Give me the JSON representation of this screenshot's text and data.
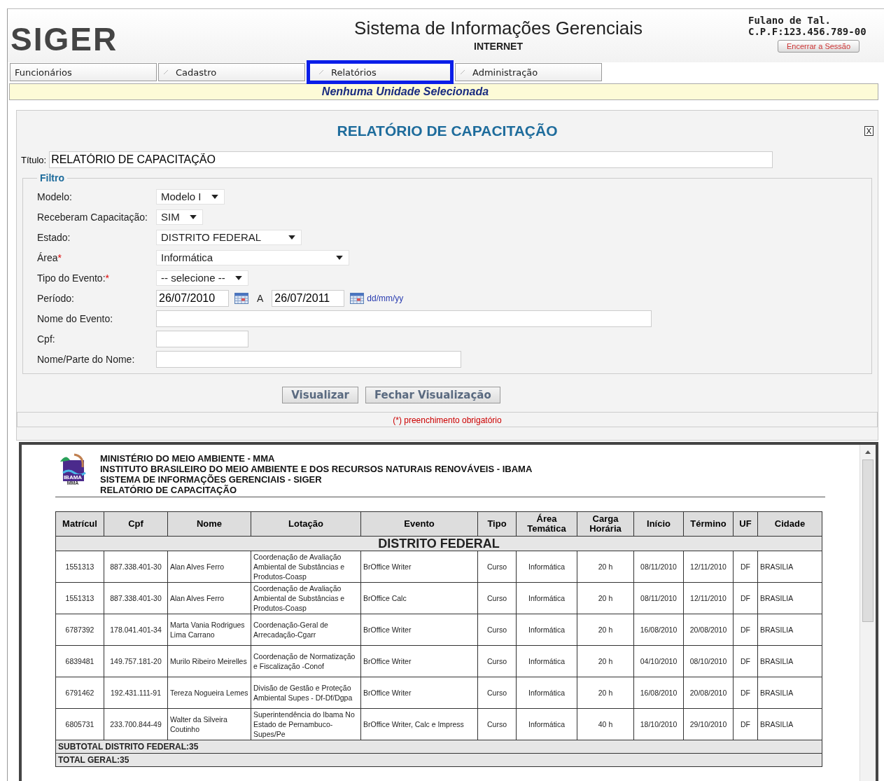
{
  "header": {
    "logo": "SIGER",
    "title": "Sistema de Informações Gerenciais",
    "subtitle": "INTERNET",
    "user_name": "Fulano de Tal.",
    "user_cpf": "C.P.F:123.456.789-00",
    "logout_button": "Encerrar a Sessão"
  },
  "tabs": [
    {
      "label": "Funcionários",
      "selected": false
    },
    {
      "label": "Cadastro",
      "selected": false
    },
    {
      "label": "Relatórios",
      "selected": true
    },
    {
      "label": "Administração",
      "selected": false
    }
  ],
  "unit_banner": "Nenhuma Unidade Selecionada",
  "panel": {
    "title": "RELATÓRIO DE CAPACITAÇÃO",
    "close": "X",
    "title_label": "Título:",
    "title_value": "RELATÓRIO DE CAPACITAÇÃO"
  },
  "filter": {
    "legend": "Filtro",
    "fields": [
      {
        "kind": "select",
        "label": "Modelo:",
        "value": "Modelo I"
      },
      {
        "kind": "select",
        "label": "Receberam Capacitação:",
        "value": "SIM"
      },
      {
        "kind": "select",
        "label": "Estado:",
        "value": "DISTRITO FEDERAL"
      },
      {
        "kind": "select",
        "label": "Área",
        "mark": "*",
        "value": "Informática"
      },
      {
        "kind": "select",
        "label": "Tipo do Evento:",
        "mark": "*",
        "value": "-- selecione --"
      },
      {
        "kind": "period",
        "label": "Período:",
        "from": "26/07/2010",
        "joiner": "A",
        "to": "26/07/2011",
        "hint": "dd/mm/yy"
      },
      {
        "kind": "text",
        "label": "Nome do Evento:"
      },
      {
        "kind": "text",
        "label": "Cpf:"
      },
      {
        "kind": "text",
        "label": "Nome/Parte do Nome:"
      }
    ]
  },
  "buttons": [
    "Visualizar",
    "Fechar Visualização"
  ],
  "required_note": "(*) preenchimento obrigatório",
  "report": {
    "heading_lines": [
      "MINISTÉRIO DO MEIO AMBIENTE - MMA",
      "INSTITUTO BRASILEIRO DO MEIO AMBIENTE E DOS RECURSOS NATURAIS RENOVÁVEIS - IBAMA",
      "SISTEMA DE INFORMAÇÕES GERENCIAIS - SIGER",
      "RELATÓRIO DE CAPACITAÇÃO"
    ],
    "logo_text": "IBAMA",
    "logo_sub": "MMA",
    "columns": [
      "Matrícul",
      "Cpf",
      "Nome",
      "Lotação",
      "Evento",
      "Tipo",
      "Área Temática",
      "Carga Horária",
      "Início",
      "Término",
      "UF",
      "Cidade"
    ],
    "group": "DISTRITO FEDERAL",
    "rows": [
      [
        "1551313",
        "887.338.401-30",
        "Alan Alves Ferro",
        "Coordenação de Avaliação Ambiental de Substâncias e Produtos-Coasp",
        "BrOffice Writer",
        "Curso",
        "Informática",
        "20 h",
        "08/11/2010",
        "12/11/2010",
        "DF",
        "BRASILIA"
      ],
      [
        "1551313",
        "887.338.401-30",
        "Alan Alves Ferro",
        "Coordenação de Avaliação Ambiental de Substâncias e Produtos-Coasp",
        "BrOffice Calc",
        "Curso",
        "Informática",
        "20 h",
        "08/11/2010",
        "12/11/2010",
        "DF",
        "BRASILIA"
      ],
      [
        "6787392",
        "178.041.401-34",
        "Marta Vania Rodrigues Lima Carrano",
        "Coordenação-Geral de Arrecadação-Cgarr",
        "BrOffice Writer",
        "Curso",
        "Informática",
        "20 h",
        "16/08/2010",
        "20/08/2010",
        "DF",
        "BRASILIA"
      ],
      [
        "6839481",
        "149.757.181-20",
        "Murilo Ribeiro Meirelles",
        "Coordenação de Normatização e Fiscalização -Conof",
        "BrOffice Writer",
        "Curso",
        "Informática",
        "20 h",
        "04/10/2010",
        "08/10/2010",
        "DF",
        "BRASILIA"
      ],
      [
        "6791462",
        "192.431.111-91",
        "Tereza Nogueira Lemes",
        "Divisão de Gestão e Proteção Ambiental Supes - Df-Df/Dgpa",
        "BrOffice Writer",
        "Curso",
        "Informática",
        "20 h",
        "16/08/2010",
        "20/08/2010",
        "DF",
        "BRASILIA"
      ],
      [
        "6805731",
        "233.700.844-49",
        "Walter da Silveira Coutinho",
        "Superintendência do Ibama No Estado de Pernambuco-Supes/Pe",
        "BrOffice Writer, Calc e Impress",
        "Curso",
        "Informática",
        "40 h",
        "18/10/2010",
        "29/10/2010",
        "DF",
        "BRASILIA"
      ]
    ],
    "subtotal": "SUBTOTAL DISTRITO FEDERAL:35",
    "total": "TOTAL GERAL:35"
  }
}
